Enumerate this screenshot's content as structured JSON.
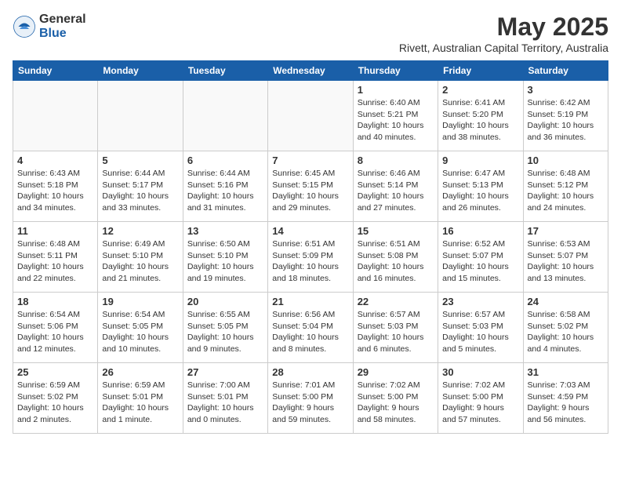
{
  "logo": {
    "general": "General",
    "blue": "Blue"
  },
  "title": "May 2025",
  "location": "Rivett, Australian Capital Territory, Australia",
  "days_of_week": [
    "Sunday",
    "Monday",
    "Tuesday",
    "Wednesday",
    "Thursday",
    "Friday",
    "Saturday"
  ],
  "weeks": [
    [
      {
        "day": "",
        "info": ""
      },
      {
        "day": "",
        "info": ""
      },
      {
        "day": "",
        "info": ""
      },
      {
        "day": "",
        "info": ""
      },
      {
        "day": "1",
        "info": "Sunrise: 6:40 AM\nSunset: 5:21 PM\nDaylight: 10 hours\nand 40 minutes."
      },
      {
        "day": "2",
        "info": "Sunrise: 6:41 AM\nSunset: 5:20 PM\nDaylight: 10 hours\nand 38 minutes."
      },
      {
        "day": "3",
        "info": "Sunrise: 6:42 AM\nSunset: 5:19 PM\nDaylight: 10 hours\nand 36 minutes."
      }
    ],
    [
      {
        "day": "4",
        "info": "Sunrise: 6:43 AM\nSunset: 5:18 PM\nDaylight: 10 hours\nand 34 minutes."
      },
      {
        "day": "5",
        "info": "Sunrise: 6:44 AM\nSunset: 5:17 PM\nDaylight: 10 hours\nand 33 minutes."
      },
      {
        "day": "6",
        "info": "Sunrise: 6:44 AM\nSunset: 5:16 PM\nDaylight: 10 hours\nand 31 minutes."
      },
      {
        "day": "7",
        "info": "Sunrise: 6:45 AM\nSunset: 5:15 PM\nDaylight: 10 hours\nand 29 minutes."
      },
      {
        "day": "8",
        "info": "Sunrise: 6:46 AM\nSunset: 5:14 PM\nDaylight: 10 hours\nand 27 minutes."
      },
      {
        "day": "9",
        "info": "Sunrise: 6:47 AM\nSunset: 5:13 PM\nDaylight: 10 hours\nand 26 minutes."
      },
      {
        "day": "10",
        "info": "Sunrise: 6:48 AM\nSunset: 5:12 PM\nDaylight: 10 hours\nand 24 minutes."
      }
    ],
    [
      {
        "day": "11",
        "info": "Sunrise: 6:48 AM\nSunset: 5:11 PM\nDaylight: 10 hours\nand 22 minutes."
      },
      {
        "day": "12",
        "info": "Sunrise: 6:49 AM\nSunset: 5:10 PM\nDaylight: 10 hours\nand 21 minutes."
      },
      {
        "day": "13",
        "info": "Sunrise: 6:50 AM\nSunset: 5:10 PM\nDaylight: 10 hours\nand 19 minutes."
      },
      {
        "day": "14",
        "info": "Sunrise: 6:51 AM\nSunset: 5:09 PM\nDaylight: 10 hours\nand 18 minutes."
      },
      {
        "day": "15",
        "info": "Sunrise: 6:51 AM\nSunset: 5:08 PM\nDaylight: 10 hours\nand 16 minutes."
      },
      {
        "day": "16",
        "info": "Sunrise: 6:52 AM\nSunset: 5:07 PM\nDaylight: 10 hours\nand 15 minutes."
      },
      {
        "day": "17",
        "info": "Sunrise: 6:53 AM\nSunset: 5:07 PM\nDaylight: 10 hours\nand 13 minutes."
      }
    ],
    [
      {
        "day": "18",
        "info": "Sunrise: 6:54 AM\nSunset: 5:06 PM\nDaylight: 10 hours\nand 12 minutes."
      },
      {
        "day": "19",
        "info": "Sunrise: 6:54 AM\nSunset: 5:05 PM\nDaylight: 10 hours\nand 10 minutes."
      },
      {
        "day": "20",
        "info": "Sunrise: 6:55 AM\nSunset: 5:05 PM\nDaylight: 10 hours\nand 9 minutes."
      },
      {
        "day": "21",
        "info": "Sunrise: 6:56 AM\nSunset: 5:04 PM\nDaylight: 10 hours\nand 8 minutes."
      },
      {
        "day": "22",
        "info": "Sunrise: 6:57 AM\nSunset: 5:03 PM\nDaylight: 10 hours\nand 6 minutes."
      },
      {
        "day": "23",
        "info": "Sunrise: 6:57 AM\nSunset: 5:03 PM\nDaylight: 10 hours\nand 5 minutes."
      },
      {
        "day": "24",
        "info": "Sunrise: 6:58 AM\nSunset: 5:02 PM\nDaylight: 10 hours\nand 4 minutes."
      }
    ],
    [
      {
        "day": "25",
        "info": "Sunrise: 6:59 AM\nSunset: 5:02 PM\nDaylight: 10 hours\nand 2 minutes."
      },
      {
        "day": "26",
        "info": "Sunrise: 6:59 AM\nSunset: 5:01 PM\nDaylight: 10 hours\nand 1 minute."
      },
      {
        "day": "27",
        "info": "Sunrise: 7:00 AM\nSunset: 5:01 PM\nDaylight: 10 hours\nand 0 minutes."
      },
      {
        "day": "28",
        "info": "Sunrise: 7:01 AM\nSunset: 5:00 PM\nDaylight: 9 hours\nand 59 minutes."
      },
      {
        "day": "29",
        "info": "Sunrise: 7:02 AM\nSunset: 5:00 PM\nDaylight: 9 hours\nand 58 minutes."
      },
      {
        "day": "30",
        "info": "Sunrise: 7:02 AM\nSunset: 5:00 PM\nDaylight: 9 hours\nand 57 minutes."
      },
      {
        "day": "31",
        "info": "Sunrise: 7:03 AM\nSunset: 4:59 PM\nDaylight: 9 hours\nand 56 minutes."
      }
    ]
  ]
}
